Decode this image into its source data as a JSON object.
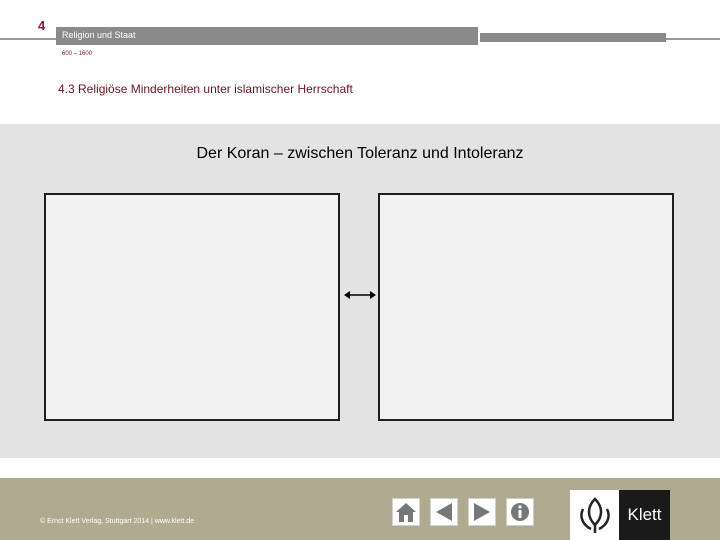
{
  "header": {
    "chapter_number": "4",
    "chapter_title": "Religion und Staat",
    "date_range": "600 – 1600",
    "section_title": "4.3 Religiöse Minderheiten unter islamischer Herrschaft"
  },
  "main": {
    "title": "Der Koran – zwischen Toleranz und Intoleranz"
  },
  "footer": {
    "copyright": "© Ernst Klett Verlag, Stuttgart 2014 | www.klett.de",
    "logo_text": "Klett",
    "nav_icons": [
      "home-icon",
      "prev-arrow-icon",
      "next-arrow-icon",
      "info-icon"
    ]
  },
  "colors": {
    "accent": "#8b1a2c",
    "header_bar": "#8a8a8a",
    "content_bg": "#e3e3e3",
    "footer_bg": "#b0aa90"
  }
}
